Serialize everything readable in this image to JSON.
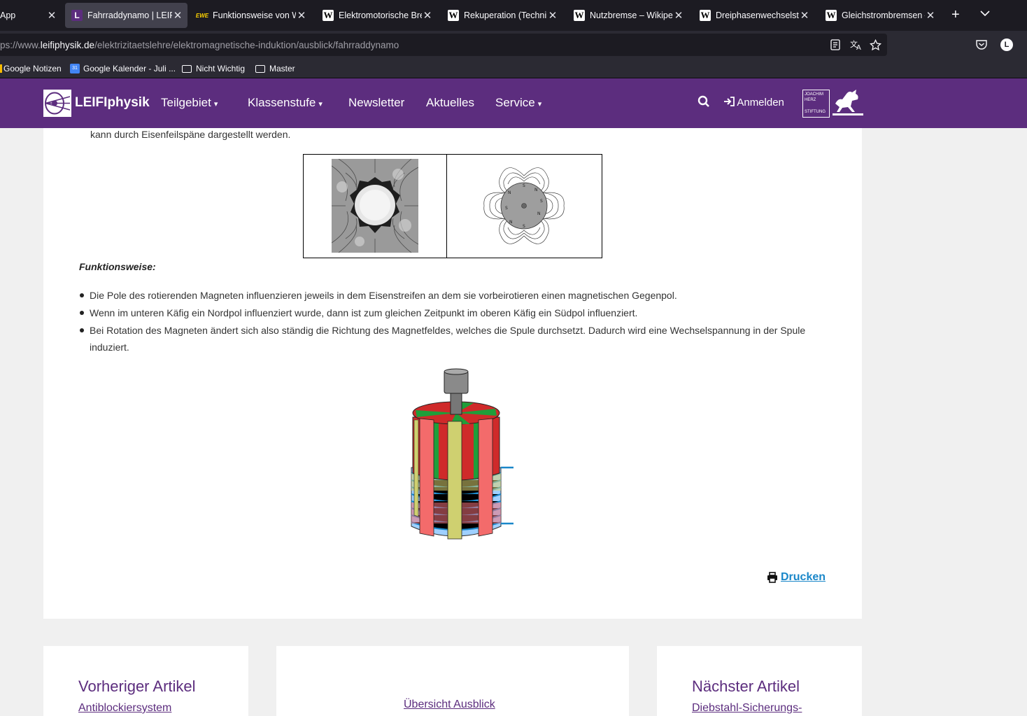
{
  "browser": {
    "tabs": [
      {
        "title": "App",
        "favicon": "none"
      },
      {
        "title": "Fahrraddynamo | LEIFIphysik",
        "favicon": "leifi-icon",
        "active": true
      },
      {
        "title": "Funktionsweise von Wirbelstrombremse",
        "favicon": "ewe-icon"
      },
      {
        "title": "Elektromotorische Bremse",
        "favicon": "wikipedia-icon"
      },
      {
        "title": "Rekuperation (Technik)",
        "favicon": "wikipedia-icon"
      },
      {
        "title": "Nutzbremse – Wikipedia",
        "favicon": "wikipedia-icon"
      },
      {
        "title": "Dreiphasenwechselstrom",
        "favicon": "wikipedia-icon"
      },
      {
        "title": "Gleichstrombremsen – ",
        "favicon": "wikipedia-icon"
      }
    ],
    "url_prefix": "ps://www.",
    "url_host": "leifiphysik.de",
    "url_path": "/elektrizitaetslehre/elektromagnetische-induktion/ausblick/fahrraddynamo",
    "profile_initial": "L",
    "bookmarks": [
      "Google Notizen",
      "Google Kalender - Juli ...",
      "Nicht Wichtig",
      "Master"
    ]
  },
  "site": {
    "logo": "LEIFIphysik",
    "nav": [
      "Teilgebiet",
      "Klassenstufe",
      "Newsletter",
      "Aktuelles",
      "Service"
    ],
    "login": "Anmelden",
    "partner_logo_text": [
      "JOACHIM",
      "HERZ",
      "STIFTUNG"
    ]
  },
  "article": {
    "intro_tail": "kann durch Eisenfeilspäne dargestellt werden.",
    "section_title": "Funktionsweise:",
    "bullets": [
      "Die Pole des rotierenden Magneten influenzieren jeweils in dem Eisenstreifen an dem sie vorbeirotieren einen magnetischen Gegenpol.",
      "Wenn im unteren Käfig ein Nordpol influenziert wurde, dann ist zum gleichen Zeitpunkt im oberen Käfig ein Südpol influenziert.",
      "Bei Rotation des Magneten ändert sich also ständig die Richtung des Magnetfeldes, welches die Spule durchsetzt. Dadurch wird eine Wechselspannung in der Spule induziert."
    ],
    "print_label": "Drucken"
  },
  "footer_cards": {
    "previous_title": "Vorheriger Artikel",
    "previous_link": "Antiblockiersystem",
    "overview_link": "Übersicht Ausblick",
    "next_title": "Nächster Artikel",
    "next_link": "Diebstahl-Sicherungs-"
  },
  "colors": {
    "brand": "#5c2d7e",
    "link": "#1a87c9"
  }
}
